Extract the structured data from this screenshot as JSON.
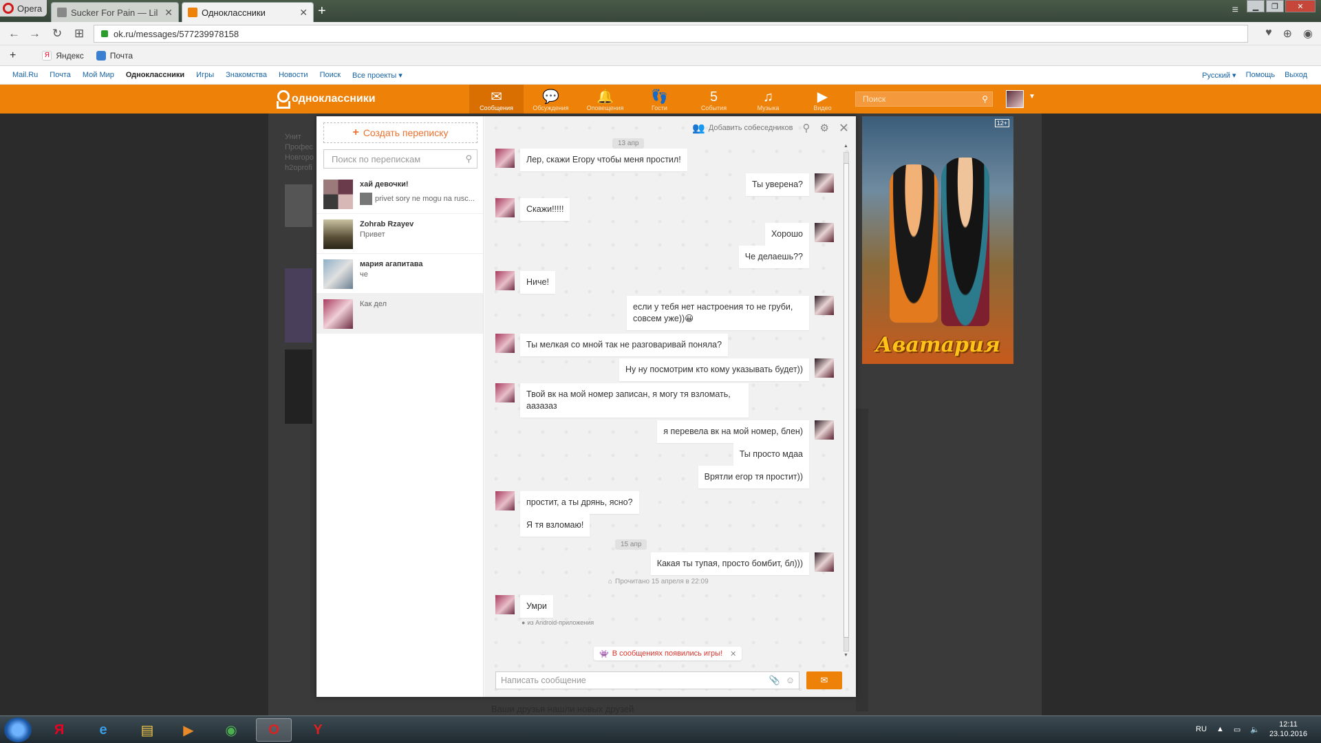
{
  "browser": {
    "menu_label": "Opera",
    "tabs": [
      {
        "title": "Sucker For Pain — Lil Wa"
      },
      {
        "title": "Одноклассники"
      }
    ],
    "url": "ok.ru/messages/577239978158",
    "bookmarks": [
      {
        "label": "Яндекс"
      },
      {
        "label": "Почта"
      }
    ]
  },
  "toplinks": {
    "left": [
      "Mail.Ru",
      "Почта",
      "Мой Мир",
      "Одноклассники",
      "Игры",
      "Знакомства",
      "Новости",
      "Поиск",
      "Все проекты ▾"
    ],
    "right": [
      "Русский ▾",
      "Помощь",
      "Выход"
    ]
  },
  "okheader": {
    "logo": "одноклассники",
    "nav": [
      {
        "label": "Сообщения",
        "icon": "envelope-icon"
      },
      {
        "label": "Обсуждения",
        "icon": "chat-icon"
      },
      {
        "label": "Оповещения",
        "icon": "bell-icon"
      },
      {
        "label": "Гости",
        "icon": "footprints-icon"
      },
      {
        "label": "События",
        "icon": "events-icon"
      },
      {
        "label": "Музыка",
        "icon": "music-icon"
      },
      {
        "label": "Видео",
        "icon": "video-icon"
      }
    ],
    "search_placeholder": "Поиск"
  },
  "background": {
    "snippet": [
      "Унит",
      "Профес",
      "Новгоро",
      "h2oprofi"
    ],
    "footer": "Ваши друзья нашли новых друзей"
  },
  "messenger": {
    "create_label": "Создать переписку",
    "search_placeholder": "Поиск по перепискам",
    "conversations": [
      {
        "name": "хай девочки!",
        "last": "privet sory ne mogu na rusc..."
      },
      {
        "name": "Zohrab Rzayev",
        "last": "Привет"
      },
      {
        "name": "мария агапитава",
        "last": "че"
      },
      {
        "name": "",
        "last": "Как дел"
      }
    ],
    "add_participants": "Добавить собеседников",
    "messages": [
      {
        "type": "date",
        "text": "13 апр"
      },
      {
        "type": "in",
        "text": "Лер, скажи Егору чтобы меня простил!",
        "avatar": true
      },
      {
        "type": "out",
        "text": "Ты уверена?",
        "avatar": true
      },
      {
        "type": "in",
        "text": "Скажи!!!!!",
        "avatar": true
      },
      {
        "type": "out",
        "text": "Хорошо",
        "avatar": true
      },
      {
        "type": "out",
        "text": "Че делаешь??",
        "avatar": false
      },
      {
        "type": "in",
        "text": "Ниче!",
        "avatar": true
      },
      {
        "type": "out",
        "text": "если у тебя нет настроения то не груби, совсем уже))😀",
        "avatar": true
      },
      {
        "type": "in",
        "text": "Ты мелкая со мной так не разговаривай поняла?",
        "avatar": true
      },
      {
        "type": "out",
        "text": "Ну ну посмотрим кто кому указывать будет))",
        "avatar": true
      },
      {
        "type": "in",
        "text": "Твой вк на мой номер записан, я могу тя взломать, аазазаз",
        "avatar": true
      },
      {
        "type": "out",
        "text": "я перевела вк на мой номер, блен)",
        "avatar": true
      },
      {
        "type": "out",
        "text": "Ты просто мдаа",
        "avatar": false
      },
      {
        "type": "out",
        "text": "Врятли егор тя простит))",
        "avatar": false
      },
      {
        "type": "in",
        "text": "простит, а ты дрянь, ясно?",
        "avatar": true
      },
      {
        "type": "in",
        "text": "Я тя взломаю!",
        "avatar": false
      },
      {
        "type": "date",
        "text": "15 апр"
      },
      {
        "type": "out",
        "text": "Какая ты тупая, просто бомбит, бл)))",
        "avatar": true
      },
      {
        "type": "in",
        "text": "Умри",
        "avatar": true
      }
    ],
    "read_note": "Прочитано 15 апреля в 22:09",
    "android_note": "из Android-приложения",
    "games_banner": "В сообщениях появились игры!",
    "composer_placeholder": "Написать сообщение"
  },
  "ad": {
    "badge": "12+",
    "brand": "Аватария"
  },
  "taskbar": {
    "lang": "RU",
    "time": "12:11",
    "date": "23.10.2016"
  }
}
